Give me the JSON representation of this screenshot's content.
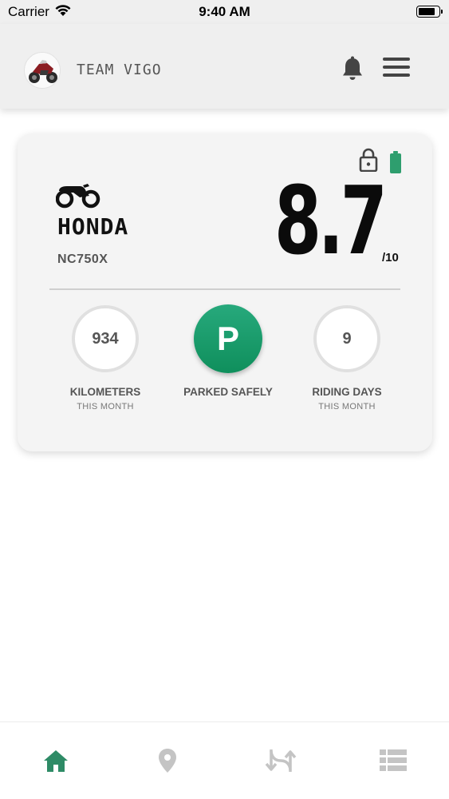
{
  "status_bar": {
    "carrier": "Carrier",
    "time": "9:40 AM"
  },
  "header": {
    "team_name": "TEAM VIGO",
    "avatar_icon": "motorcycle-photo",
    "notification_icon": "bell-icon",
    "menu_icon": "hamburger-menu-icon"
  },
  "vehicle_card": {
    "brand": "HONDA",
    "model": "NC750X",
    "score": "8.7",
    "score_max": "/10",
    "lock_icon": "lock-icon",
    "battery_icon": "battery-icon",
    "battery_color": "#2e9e6e",
    "stats": [
      {
        "value": "934",
        "label": "KILOMETERS",
        "sublabel": "THIS MONTH"
      },
      {
        "value": "P",
        "label": "PARKED SAFELY",
        "sublabel": ""
      },
      {
        "value": "9",
        "label": "RIDING DAYS",
        "sublabel": "THIS MONTH"
      }
    ]
  },
  "tab_bar": {
    "tabs": [
      {
        "icon": "home-icon",
        "active": true
      },
      {
        "icon": "location-pin-icon",
        "active": false
      },
      {
        "icon": "routes-icon",
        "active": false
      },
      {
        "icon": "list-icon",
        "active": false
      }
    ],
    "active_color": "#2e8b66",
    "inactive_color": "#c4c4c4"
  }
}
